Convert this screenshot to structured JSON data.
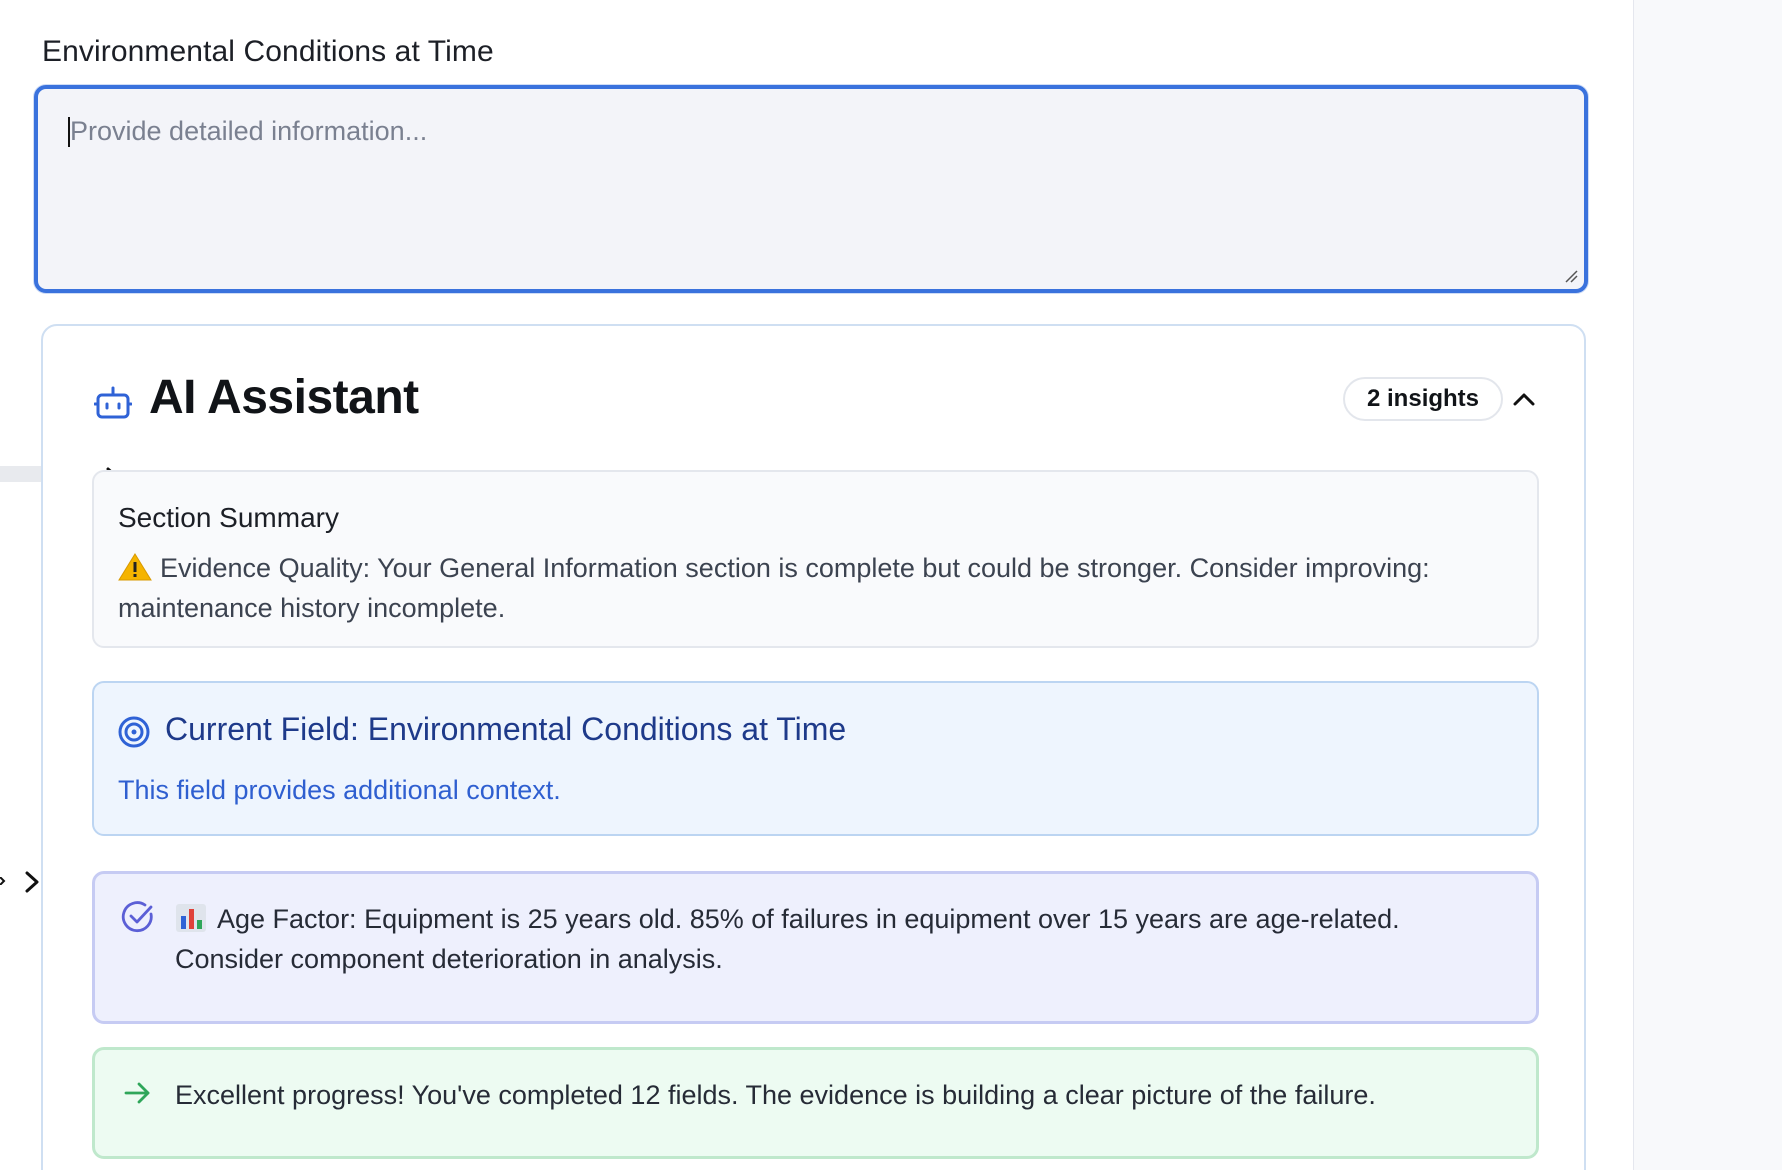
{
  "field": {
    "label": "Environmental Conditions at Time",
    "placeholder": "Provide detailed information..."
  },
  "assistant": {
    "title": "AI Assistant",
    "insights_badge": "2 insights",
    "summary": {
      "title": "Section Summary",
      "text": "Evidence Quality: Your General Information section is complete but could be stronger. Consider improving: maintenance history incomplete."
    },
    "current_field": {
      "title": "Current Field: Environmental Conditions at Time",
      "description": "This field provides additional context."
    },
    "insights": [
      {
        "text": "Age Factor: Equipment is 25 years old. 85% of failures in equipment over 15 years are age-related. Consider component deterioration in analysis."
      },
      {
        "text": "Excellent progress! You've completed 12 fields. The evidence is building a clear picture of the failure."
      }
    ]
  },
  "colors": {
    "focus_border": "#3a72dd",
    "field_box_bg": "#eef5fe",
    "age_box_bg": "#eef0fd",
    "progress_box_bg": "#edfbf2"
  },
  "icons": [
    "robot-icon",
    "chevron-up-icon",
    "chevron-right-icon",
    "warning-icon",
    "target-icon",
    "check-circle-icon",
    "bar-chart-icon",
    "arrow-right-icon"
  ]
}
